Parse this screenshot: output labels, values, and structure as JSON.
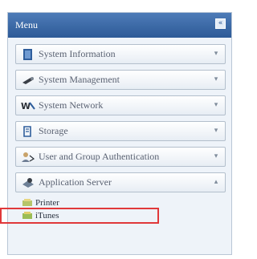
{
  "menu": {
    "title": "Menu",
    "collapse_glyph": "«",
    "items": [
      {
        "label": "System Information",
        "icon": "info-book-icon"
      },
      {
        "label": "System Management",
        "icon": "management-icon"
      },
      {
        "label": "System Network",
        "icon": "network-icon"
      },
      {
        "label": "Storage",
        "icon": "storage-icon"
      },
      {
        "label": "User and Group Authentication",
        "icon": "users-icon"
      },
      {
        "label": "Application Server",
        "icon": "app-server-icon"
      }
    ],
    "submenu": [
      {
        "label": "Printer",
        "icon": "printer-icon"
      },
      {
        "label": "iTunes",
        "icon": "itunes-icon"
      }
    ]
  },
  "colors": {
    "header": "#3a69a8",
    "highlight": "#e0383a"
  }
}
